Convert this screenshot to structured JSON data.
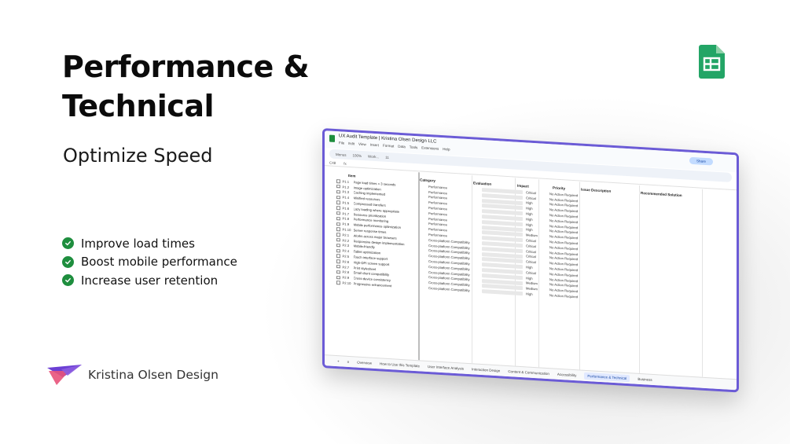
{
  "slide": {
    "title": "Performance & Technical",
    "subtitle": "Optimize Speed",
    "benefits": [
      "Improve load times",
      "Boost mobile performance",
      "Increase user retention"
    ],
    "brand_name": "Kristina Olsen Design"
  },
  "colors": {
    "check_green": "#1e8e3e",
    "window_border": "#6b5bd6",
    "sheets_green": "#23a566",
    "logo_purple": "#6b3fd4",
    "logo_pink": "#e8527a"
  },
  "spreadsheet": {
    "doc_title": "UX Audit Template | Kristina Olsen Design LLC",
    "menu": [
      "File",
      "Edit",
      "View",
      "Insert",
      "Format",
      "Data",
      "Tools",
      "Extensions",
      "Help"
    ],
    "search_label": "Menus",
    "zoom": "100%",
    "font": "Work...",
    "font_size": "11",
    "cell_ref": "C48",
    "share_label": "Share",
    "headers": {
      "item": "Item",
      "category": "Category",
      "evaluation": "Evaluation",
      "impact": "Impact",
      "priority": "Priority",
      "issue": "Issue Description",
      "solution": "Recommended Solution"
    },
    "rows": [
      {
        "id": "P1.1",
        "item": "Page load times < 3 seconds",
        "category": "Performance",
        "impact": "Critical",
        "priority": "No Action Required"
      },
      {
        "id": "P1.2",
        "item": "Image optimization",
        "category": "Performance",
        "impact": "Critical",
        "priority": "No Action Required"
      },
      {
        "id": "P1.3",
        "item": "Caching implemented",
        "category": "Performance",
        "impact": "High",
        "priority": "No Action Required"
      },
      {
        "id": "P1.4",
        "item": "Minified resources",
        "category": "Performance",
        "impact": "High",
        "priority": "No Action Required"
      },
      {
        "id": "P1.5",
        "item": "Compressed transfers",
        "category": "Performance",
        "impact": "High",
        "priority": "No Action Required"
      },
      {
        "id": "P1.6",
        "item": "Lazy loading where appropriate",
        "category": "Performance",
        "impact": "High",
        "priority": "No Action Required"
      },
      {
        "id": "P1.7",
        "item": "Resource prioritization",
        "category": "Performance",
        "impact": "High",
        "priority": "No Action Required"
      },
      {
        "id": "P1.8",
        "item": "Performance monitoring",
        "category": "Performance",
        "impact": "High",
        "priority": "No Action Required"
      },
      {
        "id": "P1.9",
        "item": "Mobile performance optimization",
        "category": "Performance",
        "impact": "Medium",
        "priority": "No Action Required"
      },
      {
        "id": "P1.10",
        "item": "Server response times",
        "category": "Performance",
        "impact": "Critical",
        "priority": "No Action Required"
      },
      {
        "id": "P2.1",
        "item": "Works across major browsers",
        "category": "Cross-platform Compatibility",
        "impact": "Critical",
        "priority": "No Action Required"
      },
      {
        "id": "P2.2",
        "item": "Responsive design implementation",
        "category": "Cross-platform Compatibility",
        "impact": "Critical",
        "priority": "No Action Required"
      },
      {
        "id": "P2.3",
        "item": "Mobile-friendly",
        "category": "Cross-platform Compatibility",
        "impact": "Critical",
        "priority": "No Action Required"
      },
      {
        "id": "P2.4",
        "item": "Tablet optimization",
        "category": "Cross-platform Compatibility",
        "impact": "Critical",
        "priority": "No Action Required"
      },
      {
        "id": "P2.5",
        "item": "Touch interface support",
        "category": "Cross-platform Compatibility",
        "impact": "High",
        "priority": "No Action Required"
      },
      {
        "id": "P2.6",
        "item": "High-DPI screen support",
        "category": "Cross-platform Compatibility",
        "impact": "Critical",
        "priority": "No Action Required"
      },
      {
        "id": "P2.7",
        "item": "Print stylesheet",
        "category": "Cross-platform Compatibility",
        "impact": "High",
        "priority": "No Action Required"
      },
      {
        "id": "P2.8",
        "item": "Email client compatibility",
        "category": "Cross-platform Compatibility",
        "impact": "Medium",
        "priority": "No Action Required"
      },
      {
        "id": "P2.9",
        "item": "Cross-device consistency",
        "category": "Cross-platform Compatibility",
        "impact": "Medium",
        "priority": "No Action Required"
      },
      {
        "id": "P2.10",
        "item": "Progressive enhancement",
        "category": "Cross-platform Compatibility",
        "impact": "High",
        "priority": "No Action Required"
      }
    ],
    "tabs": [
      "Overview",
      "How to Use this Template",
      "User Interface Analysis",
      "Interaction Design",
      "Content & Communication",
      "Accessibility",
      "Performance & Technical",
      "Business"
    ],
    "active_tab": "Performance & Technical"
  }
}
